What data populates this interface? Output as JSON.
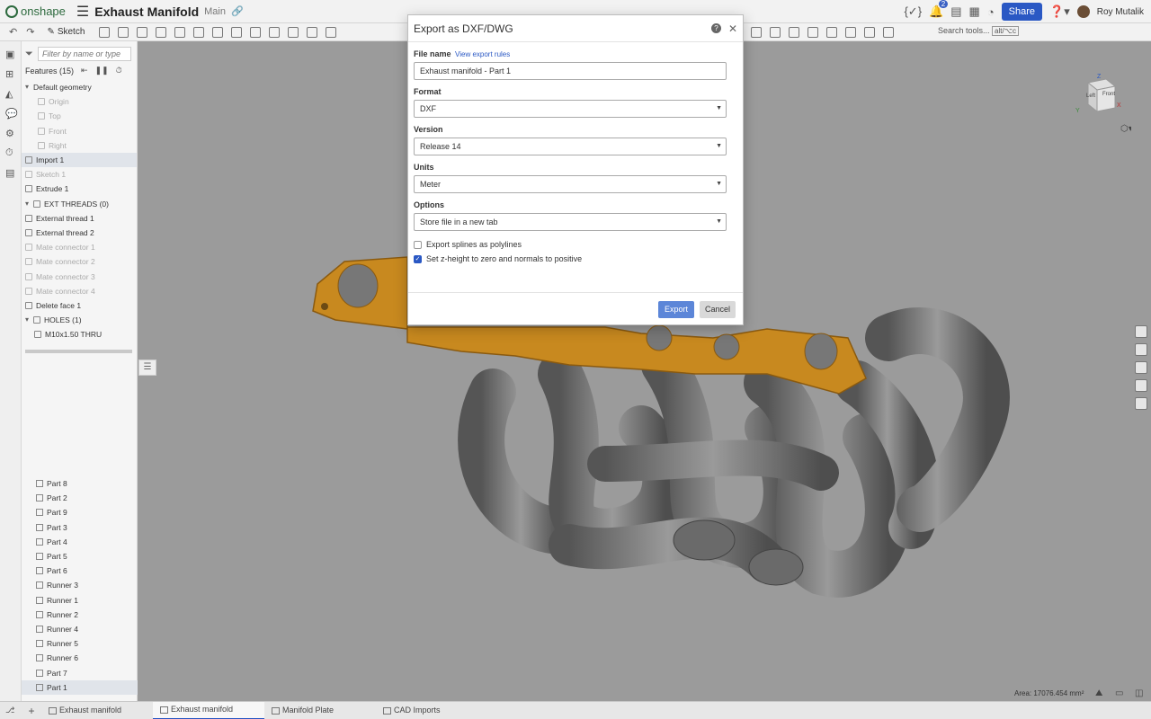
{
  "topbar": {
    "logo": "onshape",
    "doc_title": "Exhaust Manifold",
    "branch": "Main",
    "notif_count": "2",
    "share_label": "Share",
    "user_name": "Roy Mutalik"
  },
  "toolbar": {
    "sketch_label": "Sketch",
    "search_label": "Search tools...",
    "search_shortcut": "alt/⌥c"
  },
  "features": {
    "filter_placeholder": "Filter by name or type",
    "header": "Features (15)",
    "items": [
      {
        "label": "Default geometry"
      },
      {
        "label": "Origin"
      },
      {
        "label": "Top"
      },
      {
        "label": "Front"
      },
      {
        "label": "Right"
      },
      {
        "label": "Import 1"
      },
      {
        "label": "Sketch 1"
      },
      {
        "label": "Extrude 1"
      },
      {
        "label": "EXT THREADS (0)"
      },
      {
        "label": "External thread 1"
      },
      {
        "label": "External thread 2"
      },
      {
        "label": "Mate connector 1"
      },
      {
        "label": "Mate connector 2"
      },
      {
        "label": "Mate connector 3"
      },
      {
        "label": "Mate connector 4"
      },
      {
        "label": "Delete face 1"
      },
      {
        "label": "HOLES (1)"
      },
      {
        "label": "M10x1.50 THRU"
      }
    ]
  },
  "parts": {
    "items": [
      {
        "label": "Part 8"
      },
      {
        "label": "Part 2"
      },
      {
        "label": "Part 9"
      },
      {
        "label": "Part 3"
      },
      {
        "label": "Part 4"
      },
      {
        "label": "Part 5"
      },
      {
        "label": "Part 6"
      },
      {
        "label": "Runner 3"
      },
      {
        "label": "Runner 1"
      },
      {
        "label": "Runner 2"
      },
      {
        "label": "Runner 4"
      },
      {
        "label": "Runner 5"
      },
      {
        "label": "Runner 6"
      },
      {
        "label": "Part 7"
      },
      {
        "label": "Part 1"
      }
    ]
  },
  "dialog": {
    "title": "Export as DXF/DWG",
    "file_name_label": "File name",
    "export_rules_link": "View export rules",
    "file_name_value": "Exhaust manifold - Part 1",
    "format_label": "Format",
    "format_value": "DXF",
    "version_label": "Version",
    "version_value": "Release 14",
    "units_label": "Units",
    "units_value": "Meter",
    "options_label": "Options",
    "options_value": "Store file in a new tab",
    "check1_label": "Export splines as polylines",
    "check1_checked": false,
    "check2_label": "Set z-height to zero and normals to positive",
    "check2_checked": true,
    "export_label": "Export",
    "cancel_label": "Cancel"
  },
  "viewcube": {
    "left_label": "Left",
    "front_label": "Front",
    "z": "Z",
    "y": "Y",
    "x": "X"
  },
  "status": {
    "area": "Area: 17076.454 mm²"
  },
  "tabs": [
    {
      "label": "Exhaust manifold"
    },
    {
      "label": "Exhaust manifold"
    },
    {
      "label": "Manifold Plate"
    },
    {
      "label": "CAD Imports"
    }
  ],
  "colors": {
    "accent": "#2a58c4",
    "flange": "#c8891f",
    "model": "#6f6f6f"
  }
}
